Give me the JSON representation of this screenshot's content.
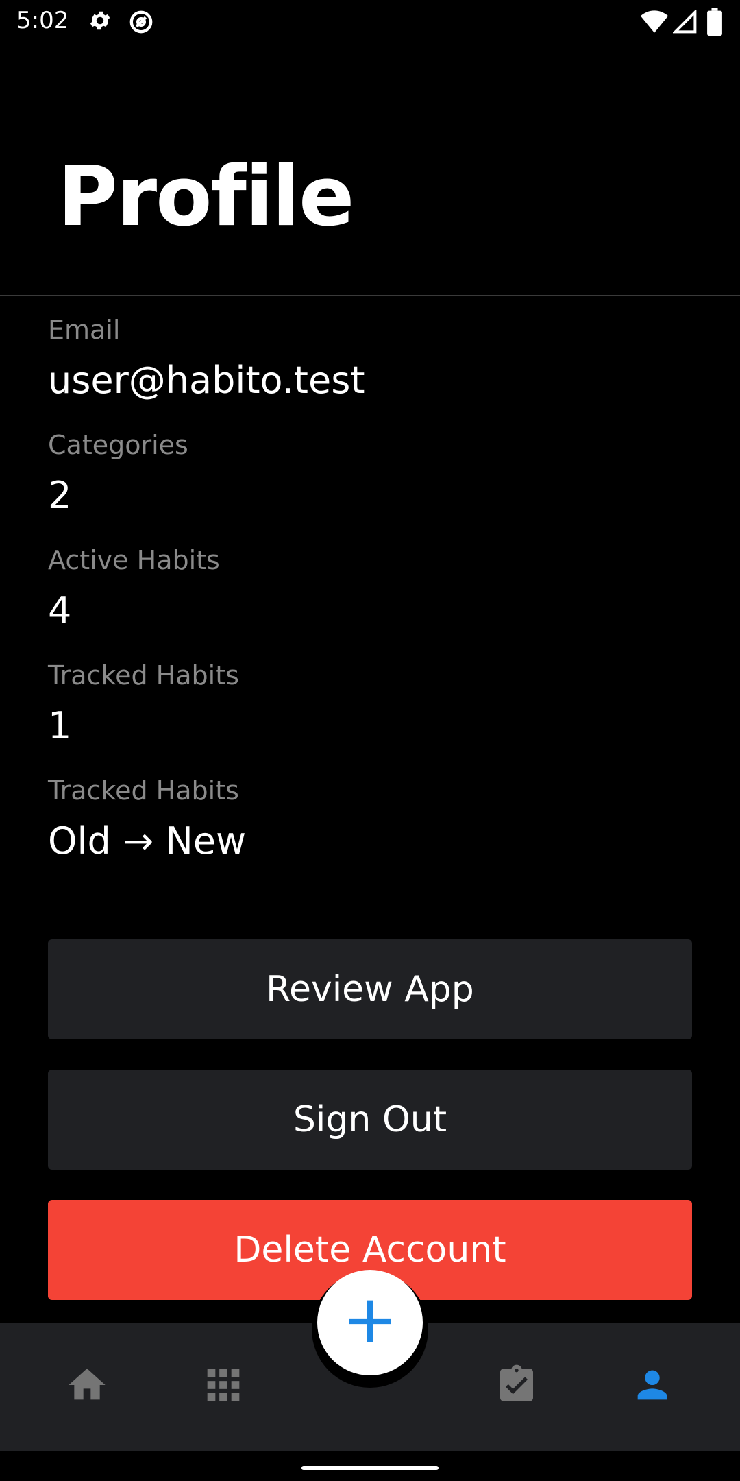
{
  "status_bar": {
    "time": "5:02"
  },
  "header": {
    "title": "Profile"
  },
  "info": [
    {
      "label": "Email",
      "value": "user@habito.test"
    },
    {
      "label": "Categories",
      "value": "2"
    },
    {
      "label": "Active Habits",
      "value": "4"
    },
    {
      "label": "Tracked Habits",
      "value": "1"
    },
    {
      "label": "Tracked Habits",
      "value": "Old → New"
    }
  ],
  "actions": {
    "review_label": "Review App",
    "sign_out_label": "Sign Out",
    "delete_label": "Delete Account"
  },
  "nav": {
    "items": [
      {
        "icon": "home-icon"
      },
      {
        "icon": "apps-grid-icon"
      },
      {
        "icon": "add-icon"
      },
      {
        "icon": "clipboard-check-icon"
      },
      {
        "icon": "person-icon",
        "active": true
      }
    ]
  },
  "colors": {
    "accent": "#1e88e5",
    "danger": "#f44336",
    "surface": "#202124",
    "background": "#000000"
  }
}
